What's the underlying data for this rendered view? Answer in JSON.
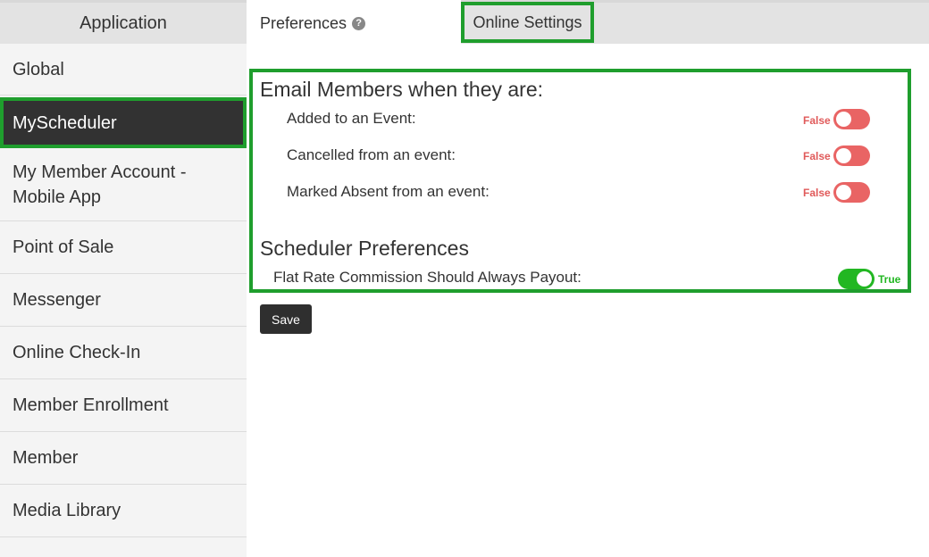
{
  "sidebar": {
    "header": "Application",
    "items": [
      {
        "label": "Global"
      },
      {
        "label": "MyScheduler"
      },
      {
        "label": "My Member Account - Mobile App"
      },
      {
        "label": "Point of Sale"
      },
      {
        "label": "Messenger"
      },
      {
        "label": "Online Check-In"
      },
      {
        "label": "Member Enrollment"
      },
      {
        "label": "Member"
      },
      {
        "label": "Media Library"
      }
    ]
  },
  "tabs": {
    "preferences": "Preferences",
    "help_icon": "?",
    "online_settings": "Online Settings"
  },
  "email_section": {
    "title": "Email Members when they are:",
    "settings": [
      {
        "label": "Added to an Event:",
        "state": "False"
      },
      {
        "label": "Cancelled from an event:",
        "state": "False"
      },
      {
        "label": "Marked Absent from an event:",
        "state": "False"
      }
    ]
  },
  "scheduler_section": {
    "title": "Scheduler Preferences",
    "settings": [
      {
        "label": "Flat Rate Commission Should Always Payout:",
        "state": "True"
      }
    ]
  },
  "actions": {
    "save_label": "Save"
  },
  "colors": {
    "accent_green": "#1f9e2d",
    "toggle_off": "#e96464",
    "toggle_on": "#22b722",
    "active_sidebar": "#323232"
  }
}
